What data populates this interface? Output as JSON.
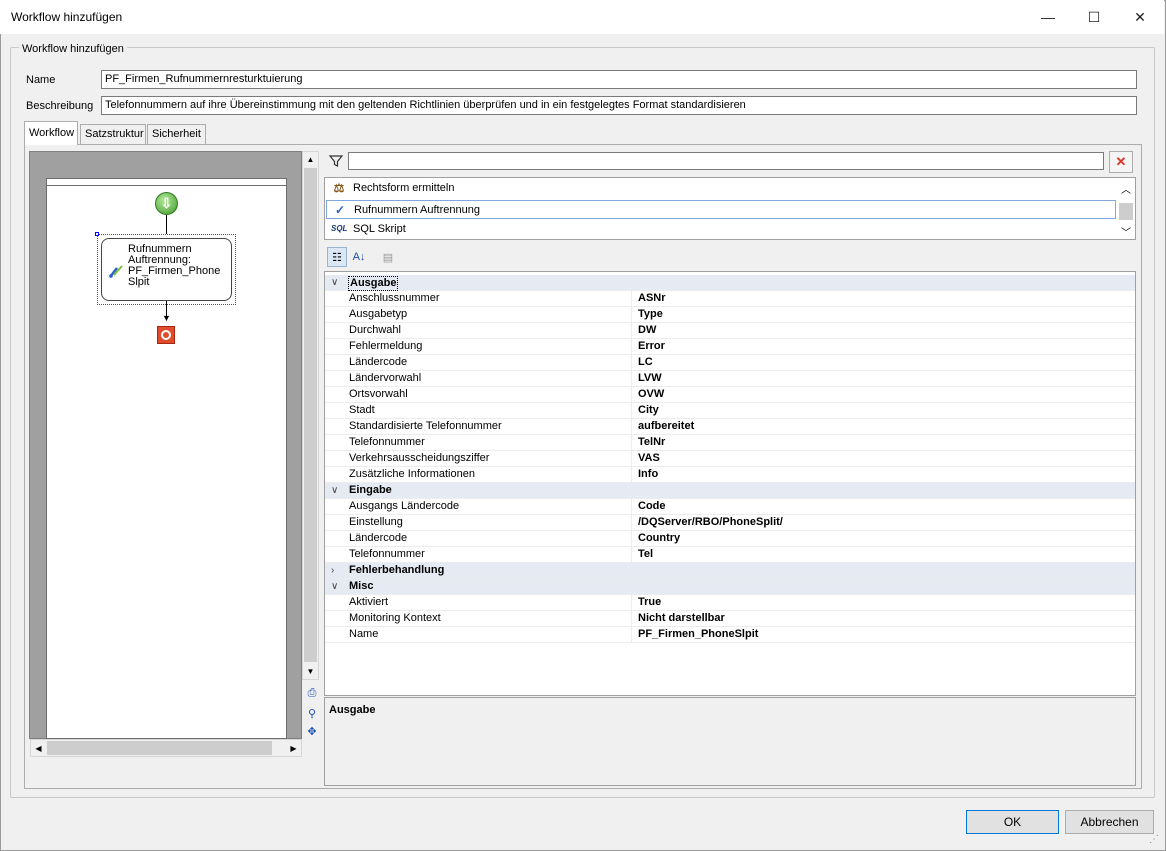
{
  "window": {
    "title": "Workflow hinzufügen",
    "minimize_glyph": "—",
    "maximize_glyph": "☐",
    "close_glyph": "✕"
  },
  "groupbox": {
    "legend": "Workflow hinzufügen"
  },
  "fields": {
    "name_label": "Name",
    "name_value": "PF_Firmen_Rufnummernresturktuierung",
    "description_label": "Beschreibung",
    "description_value": "Telefonnummern auf ihre Übereinstimmung mit den geltenden Richtlinien überprüfen und in ein festgelegtes Format standardisieren"
  },
  "tabs": [
    {
      "label": "Workflow",
      "active": true
    },
    {
      "label": "Satzstruktur",
      "active": false
    },
    {
      "label": "Sicherheit",
      "active": false
    }
  ],
  "designer": {
    "activity_text": "Rufnummern Auftrennung: PF_Firmen_Phone Slpit",
    "start_icon": "start-arrow-icon",
    "end_icon": "stop-icon"
  },
  "activity_list": {
    "filter_value": "",
    "items": [
      {
        "label": "Rechtsform ermitteln",
        "icon": "scales-icon",
        "glyph": "⚖",
        "selected": false
      },
      {
        "label": "Rufnummern Auftrennung",
        "icon": "split-phone-icon",
        "glyph": "✓",
        "selected": true
      },
      {
        "label": "SQL Skript",
        "icon": "sql-icon",
        "glyph": "SQL",
        "selected": false
      }
    ]
  },
  "properties": {
    "categories": [
      {
        "name": "Ausgabe",
        "expanded": true,
        "rows": [
          {
            "name": "Anschlussnummer",
            "value": "ASNr"
          },
          {
            "name": "Ausgabetyp",
            "value": "Type"
          },
          {
            "name": "Durchwahl",
            "value": "DW"
          },
          {
            "name": "Fehlermeldung",
            "value": "Error"
          },
          {
            "name": "Ländercode",
            "value": "LC"
          },
          {
            "name": "Ländervorwahl",
            "value": "LVW"
          },
          {
            "name": "Ortsvorwahl",
            "value": "OVW"
          },
          {
            "name": "Stadt",
            "value": "City"
          },
          {
            "name": "Standardisierte Telefonnummer",
            "value": "aufbereitet"
          },
          {
            "name": "Telefonnummer",
            "value": "TelNr"
          },
          {
            "name": "Verkehrsausscheidungsziffer",
            "value": "VAS"
          },
          {
            "name": "Zusätzliche Informationen",
            "value": "Info"
          }
        ]
      },
      {
        "name": "Eingabe",
        "expanded": true,
        "rows": [
          {
            "name": "Ausgangs Ländercode",
            "value": "Code"
          },
          {
            "name": "Einstellung",
            "value": "/DQServer/RBO/PhoneSplit/"
          },
          {
            "name": "Ländercode",
            "value": "Country"
          },
          {
            "name": "Telefonnummer",
            "value": "Tel"
          }
        ]
      },
      {
        "name": "Fehlerbehandlung",
        "expanded": false,
        "rows": []
      },
      {
        "name": "Misc",
        "expanded": true,
        "rows": [
          {
            "name": "Aktiviert",
            "value": "True"
          },
          {
            "name": "Monitoring Kontext",
            "value": "Nicht darstellbar"
          },
          {
            "name": "Name",
            "value": "PF_Firmen_PhoneSlpit"
          }
        ]
      }
    ],
    "help_title": "Ausgabe"
  },
  "buttons": {
    "ok": "OK",
    "cancel": "Abbrechen"
  }
}
